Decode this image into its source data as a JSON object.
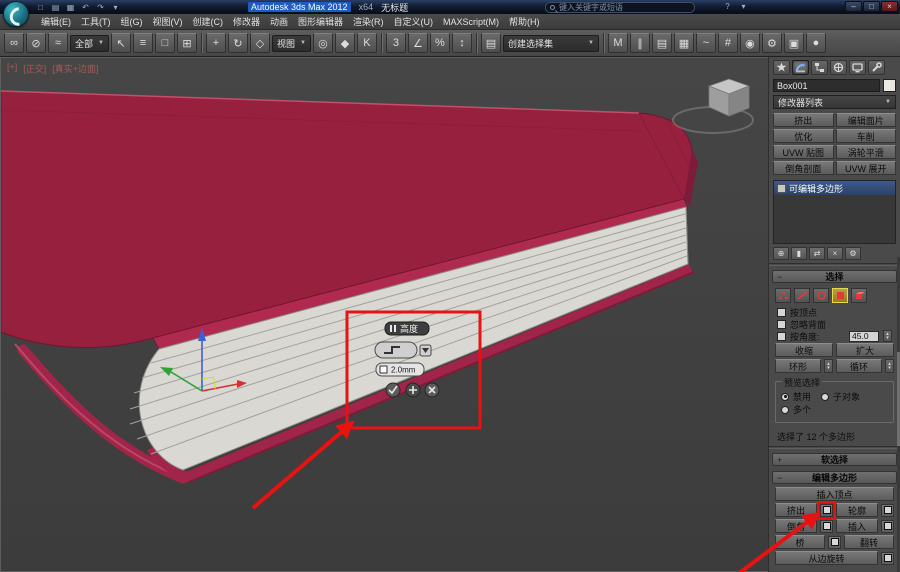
{
  "icons": {
    "dropdown": "▼",
    "spin_up": "▴",
    "spin_down": "▾",
    "collapse": "−",
    "expand": "+",
    "minimize": "–",
    "maximize": "□",
    "close": "×"
  },
  "titlebar": {
    "app_title": "Autodesk 3ds Max 2012",
    "arch": "x64",
    "doc_title": "无标题",
    "search_placeholder": "键入关键字或短语",
    "quick_icons": [
      {
        "n": "new-file-icon",
        "g": "□"
      },
      {
        "n": "open-file-icon",
        "g": "▤"
      },
      {
        "n": "save-file-icon",
        "g": "▦"
      },
      {
        "n": "undo-icon",
        "g": "↶"
      },
      {
        "n": "redo-icon",
        "g": "↷"
      },
      {
        "n": "quick-access-dropdown-icon",
        "g": "▾"
      }
    ],
    "right_icons": [
      {
        "n": "help-icon",
        "g": "?"
      },
      {
        "n": "community-dropdown-icon",
        "g": "▾"
      }
    ]
  },
  "menubar": [
    "编辑(E)",
    "工具(T)",
    "组(G)",
    "视图(V)",
    "创建(C)",
    "修改器",
    "动画",
    "图形编辑器",
    "渲染(R)",
    "自定义(U)",
    "MAXScript(M)",
    "帮助(H)"
  ],
  "toolbar": {
    "selection_filter": "全部",
    "coord_system": "视图",
    "named_selection_sets": "创建选择集",
    "group1": [
      {
        "n": "select-and-link-icon",
        "g": "∞"
      },
      {
        "n": "unlink-selection-icon",
        "g": "⊘"
      },
      {
        "n": "bind-to-space-warp-icon",
        "g": "≈"
      }
    ],
    "group2": [
      {
        "n": "select-object-icon",
        "g": "↖"
      },
      {
        "n": "select-by-name-icon",
        "g": "≡"
      },
      {
        "n": "rectangular-selection-region-icon",
        "g": "□"
      },
      {
        "n": "window-crossing-icon",
        "g": "⊞"
      }
    ],
    "group3": [
      {
        "n": "select-and-move-icon",
        "g": "+"
      },
      {
        "n": "select-and-rotate-icon",
        "g": "↻"
      },
      {
        "n": "select-and-scale-icon",
        "g": "◇"
      }
    ],
    "group4": [
      {
        "n": "use-pivot-center-icon",
        "g": "◎"
      },
      {
        "n": "select-and-manipulate-icon",
        "g": "◆"
      },
      {
        "n": "keyboard-override-icon",
        "g": "K"
      }
    ],
    "group5": [
      {
        "n": "snaps-toggle-3d-icon",
        "g": "3"
      },
      {
        "n": "angle-snap-icon",
        "g": "∠"
      },
      {
        "n": "percent-snap-icon",
        "g": "%"
      },
      {
        "n": "spinner-snap-icon",
        "g": "↕"
      }
    ],
    "group6": [
      {
        "n": "edit-named-selection-sets-icon",
        "g": "▤"
      }
    ],
    "group7": [
      {
        "n": "mirror-icon",
        "g": "M"
      },
      {
        "n": "align-icon",
        "g": "∥"
      },
      {
        "n": "layer-manager-icon",
        "g": "▤"
      },
      {
        "n": "graphite-modeling-icon",
        "g": "▦"
      },
      {
        "n": "curve-editor-icon",
        "g": "~"
      },
      {
        "n": "schematic-view-icon",
        "g": "#"
      },
      {
        "n": "material-editor-icon",
        "g": "◉"
      },
      {
        "n": "render-setup-icon",
        "g": "⚙"
      },
      {
        "n": "rendered-frame-icon",
        "g": "▣"
      },
      {
        "n": "render-production-icon",
        "g": "●"
      }
    ]
  },
  "viewport": {
    "labels": [
      "[+]",
      "[正交]",
      "[真实+边面]"
    ],
    "caddy": {
      "title": "高度",
      "value": "2.0mm"
    }
  },
  "panel": {
    "object_name": "Box001",
    "modifier_list": "修改器列表",
    "modifier_buttons": [
      "挤出",
      "编辑面片",
      "优化",
      "车削",
      "UVW 贴图",
      "涡轮平滑",
      "倒角剖面",
      "UVW 展开"
    ],
    "stack_item": "可编辑多边形",
    "stack_tools": [
      {
        "n": "pin-stack-icon",
        "g": "⊕"
      },
      {
        "n": "show-end-result-icon",
        "g": "▮"
      },
      {
        "n": "make-unique-icon",
        "g": "⇄"
      },
      {
        "n": "remove-modifier-icon",
        "g": "×"
      },
      {
        "n": "configure-modifier-sets-icon",
        "g": "⚙"
      }
    ],
    "selection": {
      "title": "选择",
      "by_vertex": "按顶点",
      "ignore_backfacing": "忽略背面",
      "by_angle": "按角度:",
      "angle_value": "45.0",
      "shrink": "收缩",
      "grow": "扩大",
      "ring": "环形",
      "loop": "循环",
      "preview_title": "预览选择",
      "preview_options": [
        "禁用",
        "子对象",
        "多个"
      ],
      "status": "选择了 12 个多边形"
    },
    "soft_selection_title": "软选择",
    "edit_poly": {
      "title": "编辑多边形",
      "insert_vertex": "插入顶点",
      "extrude": "挤出",
      "outline": "轮廓",
      "bevel": "倒角",
      "inset": "插入",
      "bridge": "桥",
      "flip": "翻转",
      "hinge": "从边旋转"
    }
  }
}
